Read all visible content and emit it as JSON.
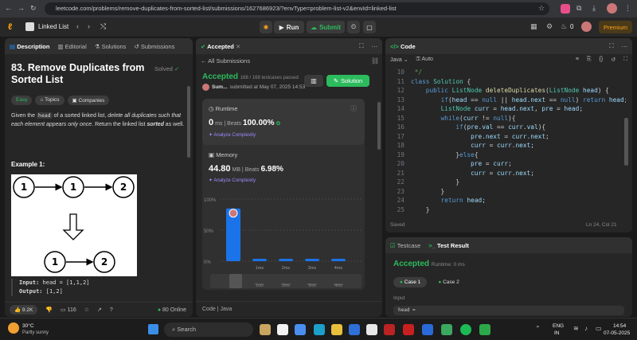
{
  "browser": {
    "url": "leetcode.com/problems/remove-duplicates-from-sorted-list/submissions/1627686923/?envType=problem-list-v2&envId=linked-list"
  },
  "nav": {
    "list": "Linked List",
    "run": "Run",
    "submit": "Submit",
    "fire_count": "0",
    "premium": "Premium"
  },
  "left": {
    "tabs": [
      "Description",
      "Editorial",
      "Solutions",
      "Submissions"
    ],
    "title_line1": "83. Remove Duplicates from",
    "title_line2": "Sorted List",
    "solved": "Solved",
    "tags": [
      "Easy",
      "Topics",
      "Companies"
    ],
    "desc_a": "Given the ",
    "desc_code": "head",
    "desc_b": " of a sorted linked list, ",
    "desc_c": "delete all duplicates such that each element appears only once",
    "desc_d": ". Return the linked list ",
    "desc_e": "sorted",
    "desc_f": " as well.",
    "example": "Example 1:",
    "diagram": {
      "top": [
        "1",
        "1",
        "2"
      ],
      "bottom": [
        "1",
        "2"
      ]
    },
    "input_label": "Input:",
    "input_val": "head = [1,1,2]",
    "output_label": "Output:",
    "output_val": "[1,2]",
    "likes": "9.2K",
    "comments": "116",
    "online": "80 Online"
  },
  "mid": {
    "tab": "Accepted",
    "back": "All Submissions",
    "status": "Accepted",
    "passed": "168 / 168 testcases passed",
    "user": "Sum...",
    "submitted": "submitted at May 07, 2025 14:53",
    "solution_btn": "Solution",
    "runtime": {
      "label": "Runtime",
      "value": "0",
      "unit": "ms",
      "beats_label": "Beats",
      "beats": "100.00%",
      "analyze": "Analyze Complexity"
    },
    "memory": {
      "label": "Memory",
      "value": "44.80",
      "unit": "MB",
      "beats_label": "Beats",
      "beats": "6.98%",
      "analyze": "Analyze Complexity"
    },
    "footer_code": "Code",
    "footer_lang": "Java"
  },
  "chart_data": {
    "type": "bar",
    "categories": [
      "0ms",
      "1ms",
      "2ms",
      "3ms",
      "4ms"
    ],
    "values": [
      85,
      2,
      2,
      2,
      2
    ],
    "yticks": [
      "100%",
      "50%",
      "0%"
    ],
    "ylim": [
      0,
      100
    ],
    "highlight_index": 0,
    "highlight_color": "#1a73e8"
  },
  "code": {
    "tab": "Code",
    "lang": "Java",
    "auto": "Auto",
    "saved": "Saved",
    "cursor": "Ln 24, Col 21",
    "lines": [
      {
        "n": "10",
        "t": " */"
      },
      {
        "n": "11",
        "t": "class Solution {"
      },
      {
        "n": "12",
        "t": "    public ListNode deleteDuplicates(ListNode head) {"
      },
      {
        "n": "13",
        "t": "        if(head == null || head.next == null) return head;"
      },
      {
        "n": "14",
        "t": "        ListNode curr = head.next, pre = head;"
      },
      {
        "n": "15",
        "t": "        while(curr != null){"
      },
      {
        "n": "16",
        "t": "            if(pre.val == curr.val){"
      },
      {
        "n": "17",
        "t": "                pre.next = curr.next;"
      },
      {
        "n": "18",
        "t": "                curr = curr.next;"
      },
      {
        "n": "19",
        "t": "            }else{"
      },
      {
        "n": "20",
        "t": "                pre = curr;"
      },
      {
        "n": "21",
        "t": "                curr = curr.next;"
      },
      {
        "n": "22",
        "t": "            }"
      },
      {
        "n": "23",
        "t": "        }"
      },
      {
        "n": "24",
        "t": "        return head;"
      },
      {
        "n": "25",
        "t": "    }"
      }
    ]
  },
  "test": {
    "tab1": "Testcase",
    "tab2": "Test Result",
    "status": "Accepted",
    "runtime": "Runtime: 0 ms",
    "case1": "Case 1",
    "case2": "Case 2",
    "input_label": "Input",
    "input_val": "head ="
  },
  "taskbar": {
    "temp": "30°C",
    "weather": "Partly sunny",
    "search": "Search",
    "lang1": "ENG",
    "lang2": "IN",
    "time": "14:54",
    "date": "07-05-2025"
  }
}
